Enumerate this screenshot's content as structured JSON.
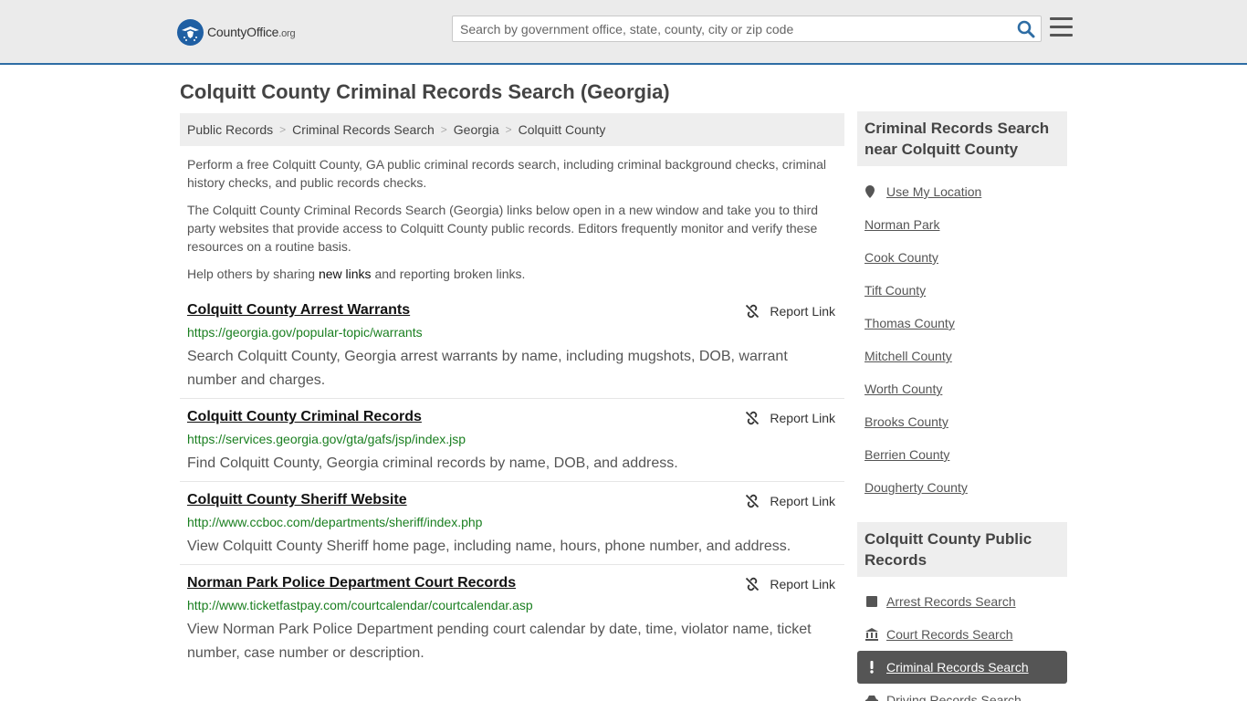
{
  "header": {
    "logo_text": "CountyOffice",
    "logo_suffix": ".org",
    "search_placeholder": "Search by government office, state, county, city or zip code"
  },
  "page_title": "Colquitt County Criminal Records Search (Georgia)",
  "breadcrumb": [
    "Public Records",
    "Criminal Records Search",
    "Georgia",
    "Colquitt County"
  ],
  "intro": {
    "p1": "Perform a free Colquitt County, GA public criminal records search, including criminal background checks, criminal history checks, and public records checks.",
    "p2": "The Colquitt County Criminal Records Search (Georgia) links below open in a new window and take you to third party websites that provide access to Colquitt County public records. Editors frequently monitor and verify these resources on a routine basis.",
    "p3_before": "Help others by sharing ",
    "p3_link": "new links",
    "p3_after": " and reporting broken links."
  },
  "report_label": "Report Link",
  "results": [
    {
      "title": "Colquitt County Arrest Warrants",
      "url": "https://georgia.gov/popular-topic/warrants",
      "desc": "Search Colquitt County, Georgia arrest warrants by name, including mugshots, DOB, warrant number and charges."
    },
    {
      "title": "Colquitt County Criminal Records",
      "url": "https://services.georgia.gov/gta/gafs/jsp/index.jsp",
      "desc": "Find Colquitt County, Georgia criminal records by name, DOB, and address."
    },
    {
      "title": "Colquitt County Sheriff Website",
      "url": "http://www.ccboc.com/departments/sheriff/index.php",
      "desc": "View Colquitt County Sheriff home page, including name, hours, phone number, and address."
    },
    {
      "title": "Norman Park Police Department Court Records",
      "url": "http://www.ticketfastpay.com/courtcalendar/courtcalendar.asp",
      "desc": "View Norman Park Police Department pending court calendar by date, time, violator name, ticket number, case number or description."
    }
  ],
  "sidebar": {
    "nearby_heading": "Criminal Records Search near Colquitt County",
    "use_location": "Use My Location",
    "nearby": [
      "Norman Park",
      "Cook County",
      "Tift County",
      "Thomas County",
      "Mitchell County",
      "Worth County",
      "Brooks County",
      "Berrien County",
      "Dougherty County"
    ],
    "public_heading": "Colquitt County Public Records",
    "public": [
      {
        "label": "Arrest Records Search",
        "icon": "square-icon"
      },
      {
        "label": "Court Records Search",
        "icon": "courthouse-icon"
      },
      {
        "label": "Criminal Records Search",
        "icon": "exclamation-icon"
      },
      {
        "label": "Driving Records Search",
        "icon": "car-icon"
      }
    ]
  },
  "colors": {
    "header_bg": "#ebebeb",
    "header_border": "#2e6da4",
    "url_green": "#1a7f20",
    "active_bg": "#555555"
  }
}
